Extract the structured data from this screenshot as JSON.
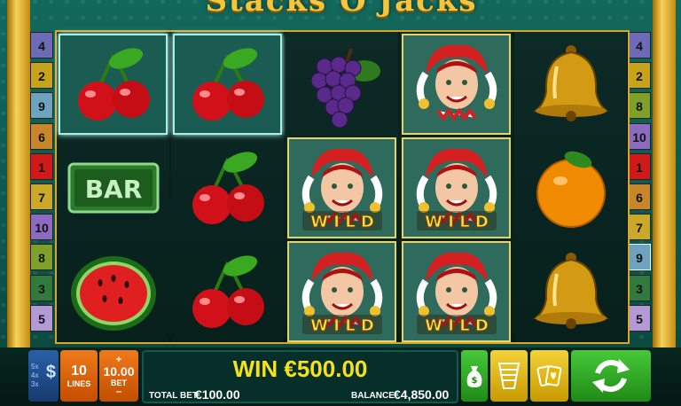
{
  "game": {
    "title": "Stacks O'Jacks"
  },
  "paylines": {
    "left": [
      "4",
      "2",
      "9",
      "6",
      "1",
      "7",
      "10",
      "8",
      "3",
      "5"
    ],
    "right": [
      "4",
      "2",
      "8",
      "10",
      "1",
      "6",
      "7",
      "9",
      "3",
      "5"
    ],
    "colors": [
      "#6d6ab8",
      "#c7a31a",
      "#6ea3bf",
      "#c8862a",
      "#d01a1a",
      "#c9a82a",
      "#8b6ac0",
      "#7fa12a",
      "#2f7a3c",
      "#b39ad6"
    ],
    "right_colors": [
      "#6d6ab8",
      "#c7a31a",
      "#7fa12a",
      "#8b6ac0",
      "#d01a1a",
      "#c8862a",
      "#c9a82a",
      "#6ea3bf",
      "#2f7a3c",
      "#b39ad6"
    ],
    "active_right": "9"
  },
  "reels": [
    [
      "cherry",
      "bar",
      "watermelon"
    ],
    [
      "cherry",
      "cherry",
      "cherry"
    ],
    [
      "grapes",
      "jester-wild",
      "jester-wild"
    ],
    [
      "jester",
      "jester-wild",
      "jester-wild"
    ],
    [
      "bell",
      "orange",
      "bell"
    ]
  ],
  "symbols": {
    "bar_text": "BAR",
    "wild_text": "W I L D"
  },
  "hud": {
    "win": "WIN €500.00",
    "total_bet_label": "TOTAL BET",
    "total_bet_value": "€100.00",
    "balance_label": "BALANCE",
    "balance_value": "€4,850.00",
    "lines_value": "10",
    "lines_label": "LINES",
    "bet_value": "10.00",
    "bet_label": "BET",
    "bet_plus": "+",
    "bet_minus": "–",
    "multipliers": [
      "5x",
      "4x",
      "3x"
    ],
    "dollar_icon": "$"
  }
}
